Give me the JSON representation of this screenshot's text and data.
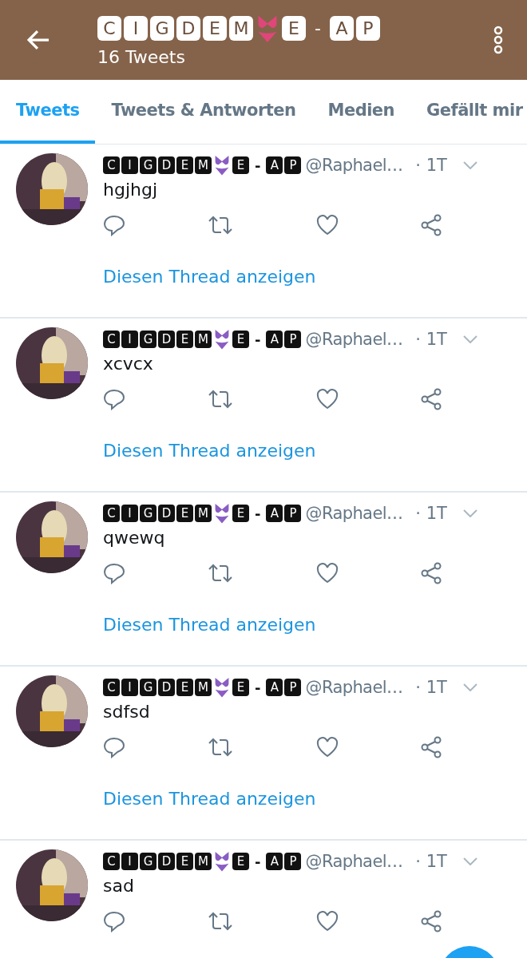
{
  "header": {
    "name": [
      {
        "kind": "tile",
        "text": "C"
      },
      {
        "kind": "tile",
        "text": "I"
      },
      {
        "kind": "tile",
        "text": "G"
      },
      {
        "kind": "tile",
        "text": "D"
      },
      {
        "kind": "tile",
        "text": "E"
      },
      {
        "kind": "tile",
        "text": "M"
      },
      {
        "kind": "emoji"
      },
      {
        "kind": "tile",
        "text": "E"
      },
      {
        "kind": "plain",
        "text": "-"
      },
      {
        "kind": "tile",
        "text": "A"
      },
      {
        "kind": "tile",
        "text": "P"
      }
    ],
    "count": "16 Tweets"
  },
  "tabs": [
    {
      "label": "Tweets",
      "selected": true
    },
    {
      "label": "Tweets & Antworten",
      "selected": false
    },
    {
      "label": "Medien",
      "selected": false
    },
    {
      "label": "Gefällt mir",
      "selected": false
    }
  ],
  "tweets": [
    {
      "name": [
        {
          "kind": "tile",
          "text": "C"
        },
        {
          "kind": "tile",
          "text": "I"
        },
        {
          "kind": "tile",
          "text": "G"
        },
        {
          "kind": "tile",
          "text": "D"
        },
        {
          "kind": "tile",
          "text": "E"
        },
        {
          "kind": "tile",
          "text": "M"
        },
        {
          "kind": "emoji"
        },
        {
          "kind": "tile",
          "text": "E"
        },
        {
          "kind": "plain",
          "text": "-"
        },
        {
          "kind": "tile",
          "text": "A"
        },
        {
          "kind": "tile",
          "text": "P"
        }
      ],
      "handle": "@Raphael…",
      "time": "· 1T",
      "text": "hgjhgj",
      "thread": "Diesen Thread anzeigen"
    },
    {
      "name": [
        {
          "kind": "tile",
          "text": "C"
        },
        {
          "kind": "tile",
          "text": "I"
        },
        {
          "kind": "tile",
          "text": "G"
        },
        {
          "kind": "tile",
          "text": "D"
        },
        {
          "kind": "tile",
          "text": "E"
        },
        {
          "kind": "tile",
          "text": "M"
        },
        {
          "kind": "emoji"
        },
        {
          "kind": "tile",
          "text": "E"
        },
        {
          "kind": "plain",
          "text": "-"
        },
        {
          "kind": "tile",
          "text": "A"
        },
        {
          "kind": "tile",
          "text": "P"
        }
      ],
      "handle": "@Raphael…",
      "time": "· 1T",
      "text": "xcvcx",
      "thread": "Diesen Thread anzeigen"
    },
    {
      "name": [
        {
          "kind": "tile",
          "text": "C"
        },
        {
          "kind": "tile",
          "text": "I"
        },
        {
          "kind": "tile",
          "text": "G"
        },
        {
          "kind": "tile",
          "text": "D"
        },
        {
          "kind": "tile",
          "text": "E"
        },
        {
          "kind": "tile",
          "text": "M"
        },
        {
          "kind": "emoji"
        },
        {
          "kind": "tile",
          "text": "E"
        },
        {
          "kind": "plain",
          "text": "-"
        },
        {
          "kind": "tile",
          "text": "A"
        },
        {
          "kind": "tile",
          "text": "P"
        }
      ],
      "handle": "@Raphael…",
      "time": "· 1T",
      "text": "qwewq",
      "thread": "Diesen Thread anzeigen"
    },
    {
      "name": [
        {
          "kind": "tile",
          "text": "C"
        },
        {
          "kind": "tile",
          "text": "I"
        },
        {
          "kind": "tile",
          "text": "G"
        },
        {
          "kind": "tile",
          "text": "D"
        },
        {
          "kind": "tile",
          "text": "E"
        },
        {
          "kind": "tile",
          "text": "M"
        },
        {
          "kind": "emoji"
        },
        {
          "kind": "tile",
          "text": "E"
        },
        {
          "kind": "plain",
          "text": "-"
        },
        {
          "kind": "tile",
          "text": "A"
        },
        {
          "kind": "tile",
          "text": "P"
        }
      ],
      "handle": "@Raphael…",
      "time": "· 1T",
      "text": "sdfsd",
      "thread": "Diesen Thread anzeigen"
    },
    {
      "name": [
        {
          "kind": "tile",
          "text": "C"
        },
        {
          "kind": "tile",
          "text": "I"
        },
        {
          "kind": "tile",
          "text": "G"
        },
        {
          "kind": "tile",
          "text": "D"
        },
        {
          "kind": "tile",
          "text": "E"
        },
        {
          "kind": "tile",
          "text": "M"
        },
        {
          "kind": "emoji"
        },
        {
          "kind": "tile",
          "text": "E"
        },
        {
          "kind": "plain",
          "text": "-"
        },
        {
          "kind": "tile",
          "text": "A"
        },
        {
          "kind": "tile",
          "text": "P"
        }
      ],
      "handle": "@Raphael…",
      "time": "· 1T",
      "text": "sad"
    }
  ]
}
